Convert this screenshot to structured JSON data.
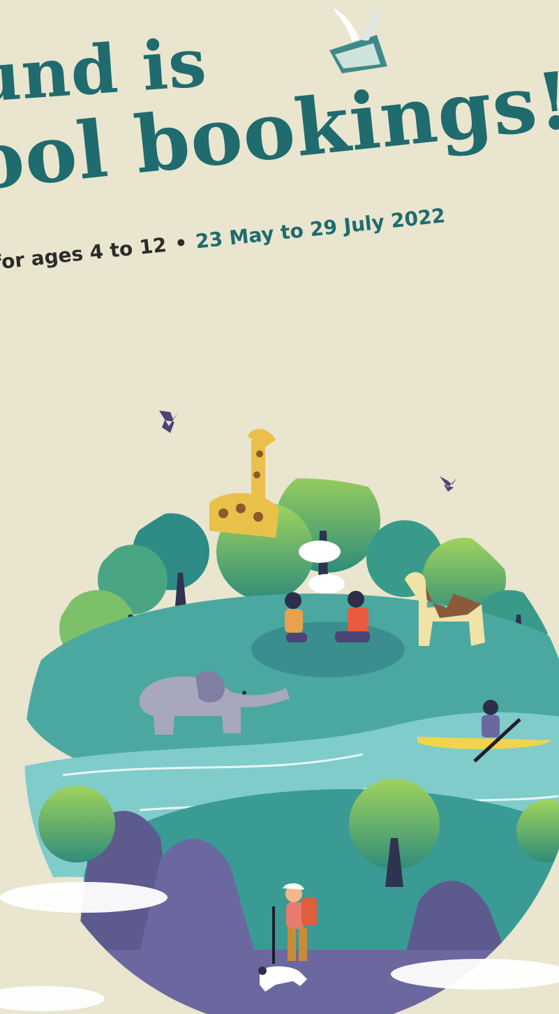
{
  "headline": {
    "line1": "und is",
    "line2": "ool bookings!"
  },
  "subtitle": {
    "ages": "for ages 4 to 12",
    "separator": "•",
    "dates": "23 May to 29 July 2022"
  },
  "colors": {
    "background": "#e9e5cf",
    "headline": "#1f6b6e",
    "subtitle_ages": "#2b2b2b"
  }
}
